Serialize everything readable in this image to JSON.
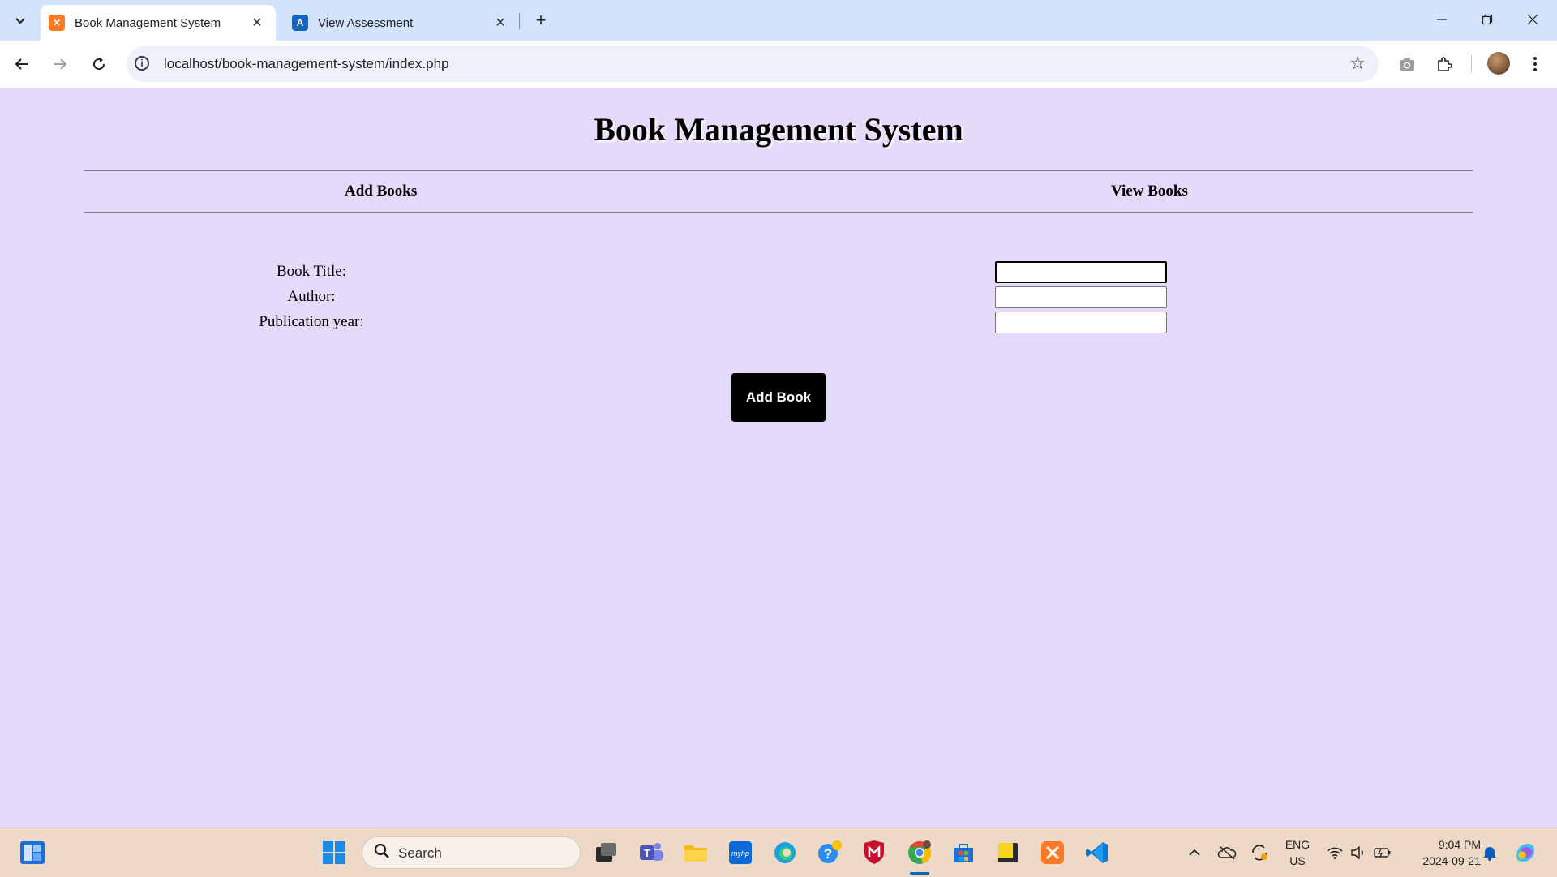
{
  "browser": {
    "tabs": [
      {
        "title": "Book Management System",
        "active": true,
        "icon": "xampp-icon",
        "icon_color": "#fb7a24"
      },
      {
        "title": "View Assessment",
        "active": false,
        "icon": "assessment-icon",
        "icon_color": "#1565c0"
      }
    ],
    "url": "localhost/book-management-system/index.php"
  },
  "page": {
    "title": "Book Management System",
    "nav": {
      "add_books": "Add Books",
      "view_books": "View Books"
    },
    "form": {
      "title_label": "Book Title:",
      "author_label": "Author:",
      "year_label": "Publication year:",
      "title_value": "",
      "author_value": "",
      "year_value": "",
      "submit_label": "Add Book"
    },
    "background_color": "#e6dafa"
  },
  "taskbar": {
    "search_placeholder": "Search",
    "language_line1": "ENG",
    "language_line2": "US",
    "time": "9:04 PM",
    "date": "2024-09-21"
  }
}
